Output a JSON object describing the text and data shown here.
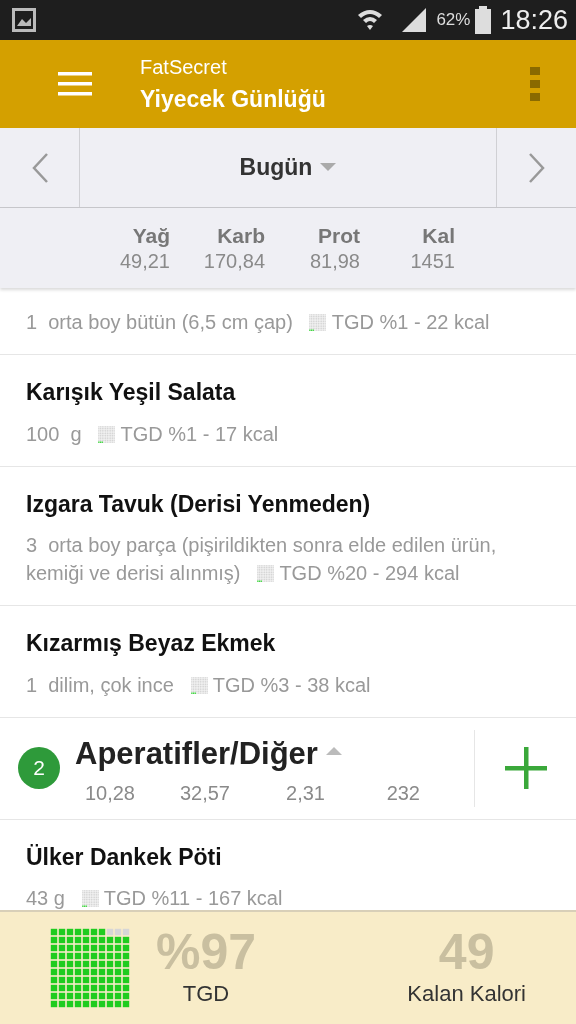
{
  "status_bar": {
    "battery": "62%",
    "time": "18:26"
  },
  "app_bar": {
    "app_name": "FatSecret",
    "title": "Yiyecek Günlüğü"
  },
  "date_nav": {
    "label": "Bugün"
  },
  "totals": [
    {
      "label": "Yağ",
      "value": "49,21"
    },
    {
      "label": "Karb",
      "value": "170,84"
    },
    {
      "label": "Prot",
      "value": "81,98"
    },
    {
      "label": "Kal",
      "value": "1451"
    }
  ],
  "entries": [
    {
      "kind": "food",
      "portion": "1  orta boy bütün (6,5 cm çap)",
      "rdi": "TGD %1 - 22 kcal"
    },
    {
      "kind": "food",
      "name": "Karışık Yeşil Salata",
      "portion": "100  g",
      "rdi": "TGD %1 - 17 kcal"
    },
    {
      "kind": "food",
      "name": "Izgara Tavuk (Derisi Yenmeden)",
      "portion": "3  orta boy parça (pişirildikten sonra elde edilen ürün, kemiği ve derisi alınmış)",
      "rdi": "TGD %20 - 294 kcal"
    },
    {
      "kind": "food",
      "name": "Kızarmış Beyaz Ekmek",
      "portion": "1  dilim, çok ince",
      "rdi": "TGD %3 - 38 kcal"
    },
    {
      "kind": "meal",
      "number": "2",
      "title": "Aperatifler/Diğer",
      "expanded": true,
      "values": [
        "10,28",
        "32,57",
        "2,31",
        "232"
      ]
    },
    {
      "kind": "food",
      "name": "Ülker Dankek Pöti",
      "portion": "43 g",
      "rdi": "TGD %11 - 167 kcal"
    }
  ],
  "summary": {
    "percent": "%97",
    "percent_label": "TGD",
    "remaining": "49",
    "remaining_label": "Kalan Kalori"
  }
}
